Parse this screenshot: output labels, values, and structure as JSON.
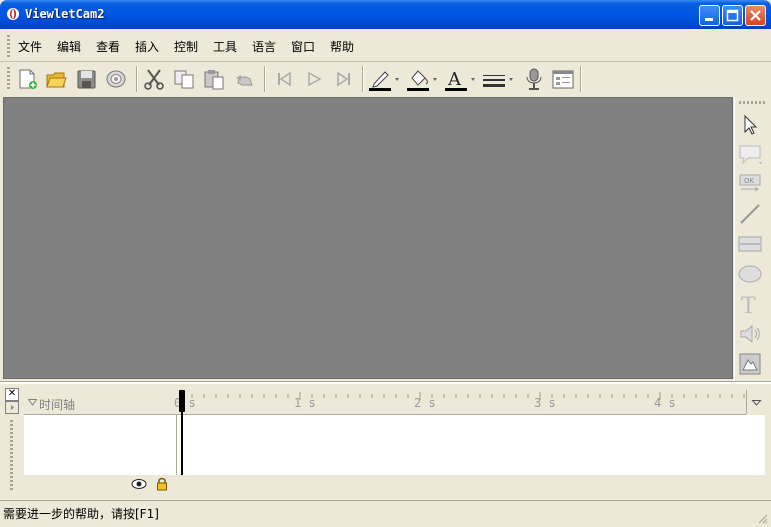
{
  "window": {
    "title": "ViewletCam2"
  },
  "menu": {
    "items": [
      "文件",
      "编辑",
      "查看",
      "插入",
      "控制",
      "工具",
      "语言",
      "窗口",
      "帮助"
    ]
  },
  "toolbar": {
    "icons": [
      "new-file-icon",
      "open-folder-icon",
      "save-icon",
      "record-icon",
      "cut-icon",
      "copy-icon",
      "paste-icon",
      "undo-icon",
      "first-frame-icon",
      "play-icon",
      "last-frame-icon",
      "line-color-icon",
      "fill-color-icon",
      "font-color-icon",
      "line-style-icon",
      "microphone-icon",
      "properties-icon"
    ]
  },
  "right_tools": {
    "icons": [
      "pointer-icon",
      "callout-icon",
      "button-icon",
      "line-icon",
      "rectangle-icon",
      "ellipse-icon",
      "text-icon",
      "sound-icon",
      "image-icon"
    ]
  },
  "timeline": {
    "header_label": "时间轴",
    "ruler_labels": [
      "0 s",
      "1 s",
      "2 s",
      "3 s",
      "4 s"
    ]
  },
  "status": {
    "text": "需要进一步的帮助，请按[F1]"
  },
  "colors": {
    "titlebar": "#0055e5",
    "canvas": "#808080",
    "chrome": "#ece9d8"
  }
}
